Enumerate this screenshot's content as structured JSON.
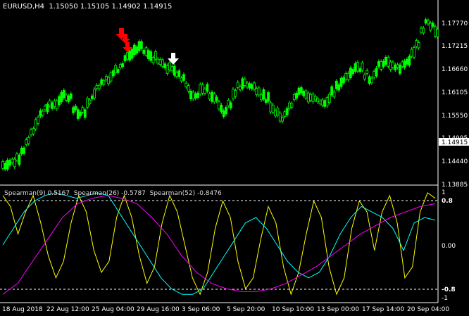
{
  "header": {
    "symbol": "EURUSD,H4",
    "ohlc": "1.15050 1.15105 1.14902 1.14915"
  },
  "price_axis": {
    "ticks": [
      "1.17770",
      "1.17215",
      "1.16660",
      "1.16105",
      "1.15550",
      "1.14995",
      "1.14440",
      "1.13885"
    ],
    "current_price": "1.14915"
  },
  "indicator": {
    "label": "Spearman(9) 0.5167  Spearman(26) -0.5787  Spearman(52) -0.8476",
    "ticks": [
      "1",
      "0.8",
      "0.00",
      "-0.8",
      "-1"
    ]
  },
  "time_axis": {
    "labels": [
      "18 Aug 2018",
      "22 Aug 12:00",
      "25 Aug 04:00",
      "29 Aug 16:00",
      "3 Sep 06:00",
      "5 Sep 20:00",
      "10 Sep 10:00",
      "13 Sep 00:00",
      "17 Sep 14:00",
      "20 Sep 04:00"
    ]
  },
  "colors": {
    "background": "#000000",
    "candle": "#00ff00",
    "axis": "#ffffff",
    "spearman9": "#ffff00",
    "spearman26": "#00ffff",
    "spearman52": "#ff00ff",
    "arrow_sell": "#ff0000",
    "arrow_other": "#ffffff",
    "price_tag_bg": "#ffffff",
    "price_tag_text": "#000000"
  },
  "chart_data": {
    "type": "line",
    "series": [
      {
        "name": "EURUSD,H4",
        "values": [
          1.1432,
          1.1438,
          1.144,
          1.145,
          1.147,
          1.1485,
          1.151,
          1.1535,
          1.1555,
          1.157,
          1.1575,
          1.158,
          1.159,
          1.16,
          1.1595,
          1.157,
          1.1555,
          1.156,
          1.158,
          1.16,
          1.162,
          1.1635,
          1.164,
          1.165,
          1.166,
          1.1675,
          1.169,
          1.17,
          1.171,
          1.1715,
          1.1705,
          1.1695,
          1.169,
          1.168,
          1.1672,
          1.1665,
          1.166,
          1.1655,
          1.164,
          1.162,
          1.1605,
          1.16,
          1.161,
          1.1615,
          1.16,
          1.159,
          1.157,
          1.156,
          1.158,
          1.16,
          1.162,
          1.163,
          1.1625,
          1.162,
          1.1615,
          1.16,
          1.159,
          1.157,
          1.1555,
          1.1545,
          1.156,
          1.158,
          1.16,
          1.161,
          1.1605,
          1.1595,
          1.159,
          1.1585,
          1.158,
          1.159,
          1.1605,
          1.162,
          1.1635,
          1.165,
          1.166,
          1.167,
          1.1665,
          1.165,
          1.164,
          1.1655,
          1.167,
          1.168,
          1.1675,
          1.167,
          1.1665,
          1.1672,
          1.168,
          1.17,
          1.1725,
          1.176,
          1.178,
          1.177,
          1.175
        ]
      },
      {
        "name": "Spearman(9)",
        "values": [
          0.9,
          0.7,
          0.2,
          0.6,
          0.9,
          0.4,
          -0.2,
          -0.6,
          -0.3,
          0.4,
          0.9,
          0.6,
          -0.1,
          -0.5,
          -0.3,
          0.5,
          0.9,
          0.5,
          -0.2,
          -0.7,
          -0.4,
          0.4,
          0.9,
          0.6,
          0.0,
          -0.6,
          -0.9,
          -0.5,
          0.3,
          0.8,
          0.5,
          -0.3,
          -0.8,
          -0.6,
          0.1,
          0.7,
          0.4,
          -0.4,
          -0.9,
          -0.5,
          0.2,
          0.8,
          0.5,
          -0.4,
          -0.9,
          -0.6,
          0.3,
          0.8,
          0.6,
          -0.1,
          0.6,
          0.9,
          0.4,
          -0.6,
          -0.4,
          0.6,
          0.95,
          0.85
        ]
      },
      {
        "name": "Spearman(26)",
        "values": [
          0.0,
          0.3,
          0.6,
          0.8,
          0.9,
          0.95,
          0.9,
          0.85,
          0.9,
          0.95,
          0.9,
          0.6,
          0.3,
          0.0,
          -0.3,
          -0.6,
          -0.8,
          -0.9,
          -0.9,
          -0.8,
          -0.5,
          -0.2,
          0.1,
          0.4,
          0.5,
          0.3,
          0.0,
          -0.3,
          -0.5,
          -0.6,
          -0.5,
          -0.2,
          0.2,
          0.5,
          0.7,
          0.6,
          0.5,
          0.3,
          -0.1,
          0.4,
          0.5,
          0.45
        ]
      },
      {
        "name": "Spearman(52)",
        "values": [
          -0.9,
          -0.7,
          -0.3,
          0.1,
          0.5,
          0.75,
          0.85,
          0.9,
          0.85,
          0.75,
          0.5,
          0.2,
          -0.2,
          -0.5,
          -0.7,
          -0.8,
          -0.85,
          -0.85,
          -0.8,
          -0.7,
          -0.55,
          -0.4,
          -0.2,
          0.0,
          0.2,
          0.35,
          0.5,
          0.6,
          0.7,
          0.75
        ]
      }
    ]
  }
}
